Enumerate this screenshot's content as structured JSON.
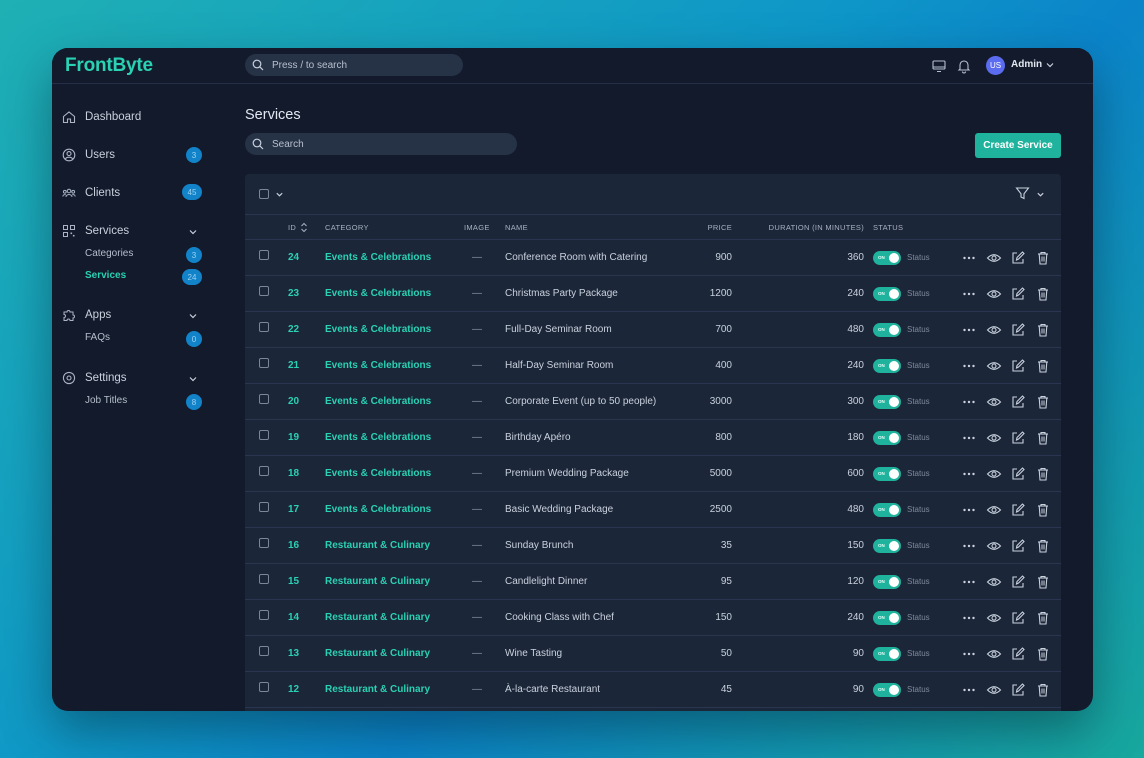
{
  "app": {
    "logo": "FrontByte"
  },
  "topbar": {
    "search_placeholder": "Press / to search",
    "user_initials": "US",
    "user_name": "Admin"
  },
  "sidebar": {
    "items": [
      {
        "label": "Dashboard",
        "icon": "home-icon"
      },
      {
        "label": "Users",
        "icon": "user-circle-icon",
        "badge": "3"
      },
      {
        "label": "Clients",
        "icon": "users-group-icon",
        "badge": "45"
      },
      {
        "label": "Services",
        "icon": "grid-icon",
        "expanded": true,
        "children": [
          {
            "label": "Categories",
            "badge": "3"
          },
          {
            "label": "Services",
            "badge": "24",
            "active": true
          }
        ]
      },
      {
        "label": "Apps",
        "icon": "puzzle-icon",
        "expanded": true,
        "children": [
          {
            "label": "FAQs",
            "badge": "0"
          }
        ]
      },
      {
        "label": "Settings",
        "icon": "gear-icon",
        "expanded": true,
        "children": [
          {
            "label": "Job Titles",
            "badge": "8"
          }
        ]
      }
    ]
  },
  "main": {
    "title": "Services",
    "search_placeholder": "Search",
    "create_label": "Create Service"
  },
  "table": {
    "columns": [
      "ID",
      "CATEGORY",
      "IMAGE",
      "NAME",
      "PRICE",
      "DURATION (IN MINUTES)",
      "STATUS"
    ],
    "toggle_on_text": "ON",
    "status_label": "Status",
    "rows": [
      {
        "id": "24",
        "category": "Events & Celebrations",
        "image": "—",
        "name": "Conference Room with Catering",
        "price": "900",
        "duration": "360"
      },
      {
        "id": "23",
        "category": "Events & Celebrations",
        "image": "—",
        "name": "Christmas Party Package",
        "price": "1200",
        "duration": "240"
      },
      {
        "id": "22",
        "category": "Events & Celebrations",
        "image": "—",
        "name": "Full-Day Seminar Room",
        "price": "700",
        "duration": "480"
      },
      {
        "id": "21",
        "category": "Events & Celebrations",
        "image": "—",
        "name": "Half-Day Seminar Room",
        "price": "400",
        "duration": "240"
      },
      {
        "id": "20",
        "category": "Events & Celebrations",
        "image": "—",
        "name": "Corporate Event (up to 50 people)",
        "price": "3000",
        "duration": "300"
      },
      {
        "id": "19",
        "category": "Events & Celebrations",
        "image": "—",
        "name": "Birthday Apéro",
        "price": "800",
        "duration": "180"
      },
      {
        "id": "18",
        "category": "Events & Celebrations",
        "image": "—",
        "name": "Premium Wedding Package",
        "price": "5000",
        "duration": "600"
      },
      {
        "id": "17",
        "category": "Events & Celebrations",
        "image": "—",
        "name": "Basic Wedding Package",
        "price": "2500",
        "duration": "480"
      },
      {
        "id": "16",
        "category": "Restaurant & Culinary",
        "image": "—",
        "name": "Sunday Brunch",
        "price": "35",
        "duration": "150"
      },
      {
        "id": "15",
        "category": "Restaurant & Culinary",
        "image": "—",
        "name": "Candlelight Dinner",
        "price": "95",
        "duration": "120"
      },
      {
        "id": "14",
        "category": "Restaurant & Culinary",
        "image": "—",
        "name": "Cooking Class with Chef",
        "price": "150",
        "duration": "240"
      },
      {
        "id": "13",
        "category": "Restaurant & Culinary",
        "image": "—",
        "name": "Wine Tasting",
        "price": "50",
        "duration": "90"
      },
      {
        "id": "12",
        "category": "Restaurant & Culinary",
        "image": "—",
        "name": "À-la-carte Restaurant",
        "price": "45",
        "duration": "90"
      }
    ]
  },
  "colors": {
    "accent": "#2ad1b4",
    "button": "#1fb29c",
    "badge": "#1283c9",
    "window": "#121a2b",
    "card": "#1b2638"
  }
}
